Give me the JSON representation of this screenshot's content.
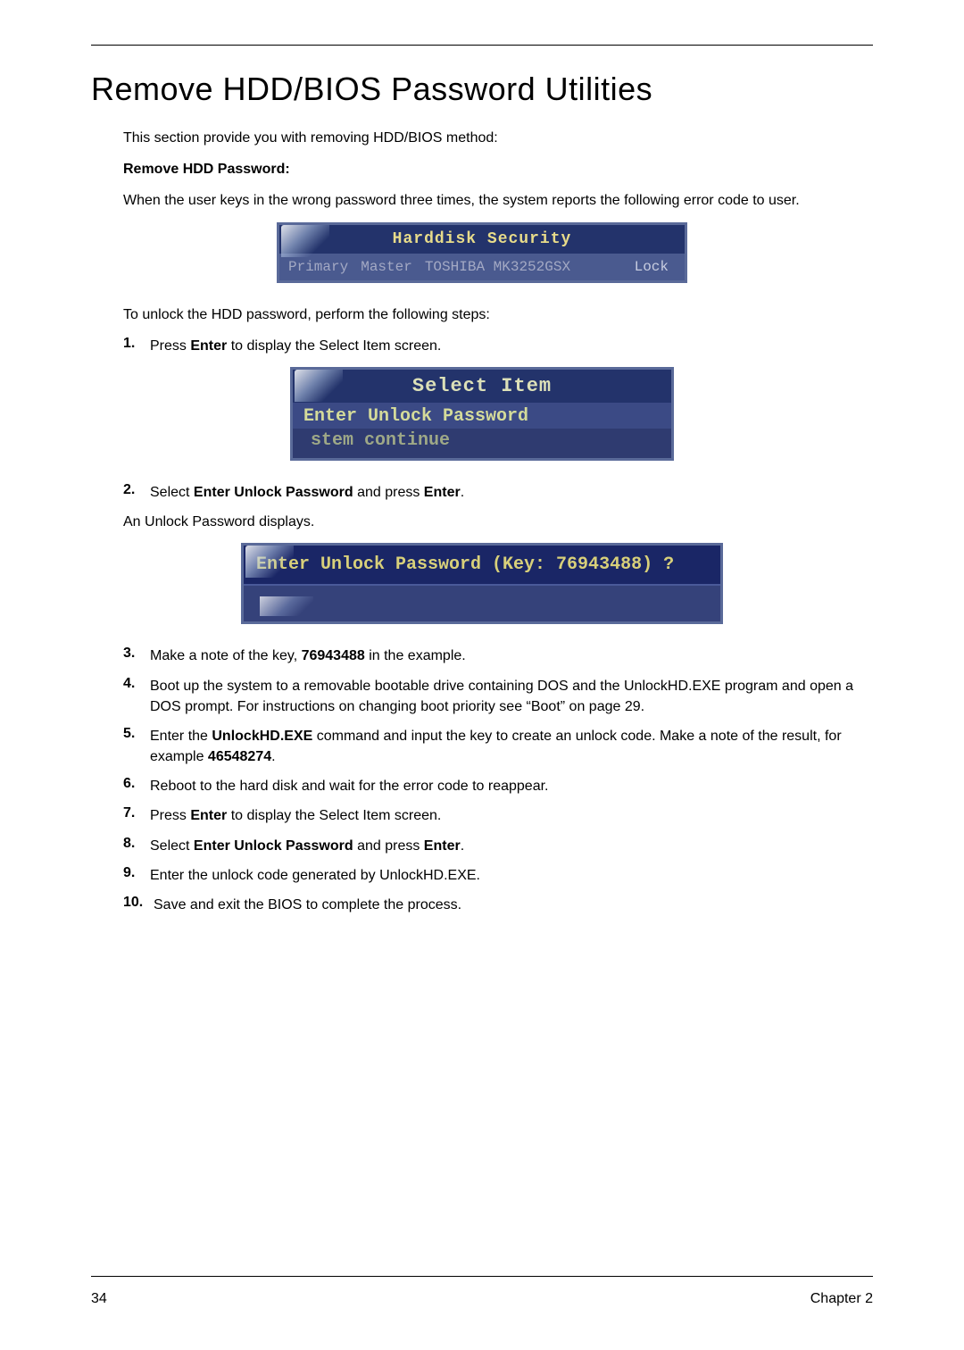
{
  "page": {
    "title": "Remove HDD/BIOS Password Utilities",
    "number": "34",
    "chapter": "Chapter 2"
  },
  "intro": {
    "line1": "This section provide you with removing HDD/BIOS method:",
    "subhead": "Remove HDD Password:",
    "line2": "When the user keys in the wrong password three times, the system reports the following error code to user."
  },
  "fig1": {
    "title": "Harddisk  Security",
    "col1": "Primary",
    "col2": "Master",
    "col3": "TOSHIBA MK3252GSX",
    "col4": "Lock"
  },
  "afterFig1": "To unlock the HDD password, perform the following steps:",
  "steps_a": [
    {
      "n": "1.",
      "pre": "Press ",
      "b1": "Enter",
      "post": " to display the Select Item screen."
    }
  ],
  "fig2": {
    "title": "Select  Item",
    "row1": "Enter Unlock Password",
    "row2": "stem continue"
  },
  "steps_b": [
    {
      "n": "2.",
      "pre": "Select ",
      "b1": "Enter Unlock Password",
      "mid": " and press ",
      "b2": "Enter",
      "post": "."
    }
  ],
  "afterStep2": "An Unlock Password displays.",
  "fig3": {
    "prompt": "Enter Unlock  Password (Key: 76943488) ?"
  },
  "steps_c": [
    {
      "n": "3.",
      "pre": "Make a note of the key, ",
      "b1": "76943488",
      "post": " in the example."
    },
    {
      "n": "4.",
      "pre": "Boot up the system to a removable bootable drive containing DOS and the UnlockHD.EXE program and open a DOS prompt. For instructions on changing boot priority see “Boot” on page 29.",
      "b1": "",
      "post": ""
    },
    {
      "n": "5.",
      "pre": "Enter the ",
      "b1": "UnlockHD.EXE",
      "mid": " command and input the key to create an unlock code. Make a note of the result, for example ",
      "b2": "46548274",
      "post": "."
    },
    {
      "n": "6.",
      "pre": "Reboot to the hard disk and wait for the error code to reappear.",
      "b1": "",
      "post": ""
    },
    {
      "n": "7.",
      "pre": "Press ",
      "b1": "Enter",
      "post": " to display the Select Item screen."
    },
    {
      "n": "8.",
      "pre": "Select ",
      "b1": "Enter Unlock Password",
      "mid": " and press ",
      "b2": "Enter",
      "post": "."
    },
    {
      "n": "9.",
      "pre": "Enter the unlock code generated by UnlockHD.EXE.",
      "b1": "",
      "post": ""
    },
    {
      "n": "10.",
      "pre": "Save and exit the BIOS to complete the process.",
      "b1": "",
      "post": ""
    }
  ]
}
